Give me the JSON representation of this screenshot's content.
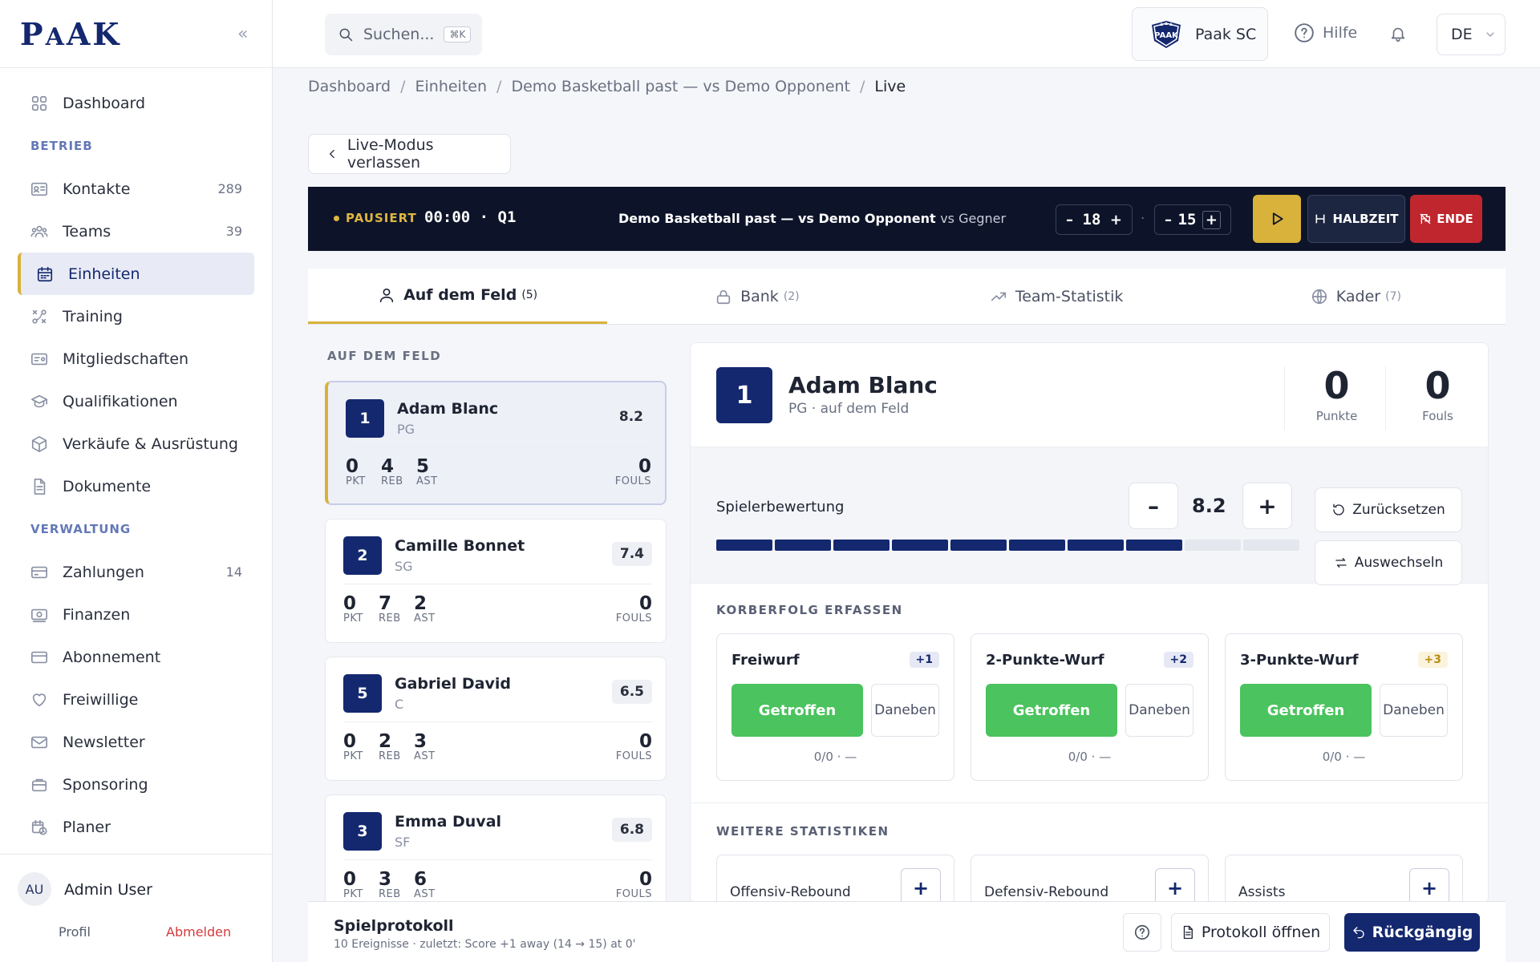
{
  "app": {
    "logo_big1": "P",
    "logo_small1": "A",
    "logo_big2": "AK",
    "collapse": "«"
  },
  "sidebar": {
    "dashboard": "Dashboard",
    "section_betrieb": "BETRIEB",
    "kontakte": {
      "label": "Kontakte",
      "count": "289"
    },
    "teams": {
      "label": "Teams",
      "count": "39"
    },
    "einheiten": "Einheiten",
    "training": "Training",
    "mitglied": "Mitgliedschaften",
    "quali": "Qualifikationen",
    "verkauf": "Verkäufe & Ausrüstung",
    "dokumente": "Dokumente",
    "section_verwaltung": "VERWALTUNG",
    "zahlungen": {
      "label": "Zahlungen",
      "count": "14"
    },
    "finanzen": "Finanzen",
    "abo": "Abonnement",
    "freiwillige": "Freiwillige",
    "newsletter": "Newsletter",
    "sponsoring": "Sponsoring",
    "planer": "Planer"
  },
  "user": {
    "initials": "AU",
    "name": "Admin User",
    "profile": "Profil",
    "logout": "Abmelden"
  },
  "topbar": {
    "search_placeholder": "Suchen...",
    "search_kbd": "⌘K",
    "club": "Paak SC",
    "help": "Hilfe",
    "lang": "DE"
  },
  "breadcrumb": {
    "b1": "Dashboard",
    "b2": "Einheiten",
    "b3": "Demo Basketball past — vs Demo Opponent",
    "b4": "Live",
    "sep": "/"
  },
  "leave": "Live-Modus verlassen",
  "live": {
    "status": "PAUSIERT",
    "clock": "00:00 · Q1",
    "game": "Demo Basketball past — vs Demo Opponent",
    "game_suffix": "vs Gegner",
    "score_home": "18",
    "score_away": "15",
    "minus": "–",
    "plus": "+",
    "mid": "·",
    "half": "HALBZEIT",
    "end": "ENDE"
  },
  "tabs": [
    {
      "label": "Auf dem Feld",
      "count": "(5)"
    },
    {
      "label": "Bank",
      "count": "(2)"
    },
    {
      "label": "Team-Statistik",
      "count": ""
    },
    {
      "label": "Kader",
      "count": "(7)"
    }
  ],
  "field_title": "AUF DEM FELD",
  "stat_labels": {
    "pts": "PKT",
    "reb": "REB",
    "ast": "AST",
    "fouls": "FOULS"
  },
  "players": [
    {
      "num": "1",
      "name": "Adam Blanc",
      "pos": "PG",
      "rating": "8.2",
      "pts": "0",
      "reb": "4",
      "ast": "5",
      "fouls": "0"
    },
    {
      "num": "2",
      "name": "Camille Bonnet",
      "pos": "SG",
      "rating": "7.4",
      "pts": "0",
      "reb": "7",
      "ast": "2",
      "fouls": "0"
    },
    {
      "num": "5",
      "name": "Gabriel David",
      "pos": "C",
      "rating": "6.5",
      "pts": "0",
      "reb": "2",
      "ast": "3",
      "fouls": "0"
    },
    {
      "num": "3",
      "name": "Emma Duval",
      "pos": "SF",
      "rating": "6.8",
      "pts": "0",
      "reb": "3",
      "ast": "6",
      "fouls": "0"
    }
  ],
  "detail": {
    "num": "1",
    "name": "Adam Blanc",
    "pos": "PG · auf dem Feld",
    "points": "0",
    "points_label": "Punkte",
    "fouls": "0",
    "fouls_label": "Fouls",
    "rating_label": "Spielerbewertung",
    "rating": "8.2",
    "rating_minus": "–",
    "rating_plus": "+",
    "rating_level_of_10": 8,
    "reset": "Zurücksetzen",
    "sub": "Auswechseln",
    "shot_title": "KORBERFOLG ERFASSEN",
    "shots": [
      {
        "name": "Freiwurf",
        "badge": "+1",
        "hit": "Getroffen",
        "miss": "Daneben",
        "line": "0/0 · —"
      },
      {
        "name": "2-Punkte-Wurf",
        "badge": "+2",
        "hit": "Getroffen",
        "miss": "Daneben",
        "line": "0/0 · —"
      },
      {
        "name": "3-Punkte-Wurf",
        "badge": "+3",
        "hit": "Getroffen",
        "miss": "Daneben",
        "line": "0/0 · —"
      }
    ],
    "more_title": "WEITERE STATISTIKEN",
    "more": [
      {
        "name": "Offensiv-Rebound",
        "add": "+"
      },
      {
        "name": "Defensiv-Rebound",
        "add": "+"
      },
      {
        "name": "Assists",
        "add": "+"
      }
    ]
  },
  "footer": {
    "title": "Spielprotokoll",
    "sub": "10 Ereignisse · zuletzt: Score +1 away (14 → 15) at 0'",
    "open": "Protokoll öffnen",
    "undo": "Rückgängig"
  },
  "colors": {
    "brand": "#14286f",
    "accent": "#d8b23a",
    "success": "#4bc35e",
    "danger": "#c0262e",
    "live_bg": "#0d1429"
  }
}
